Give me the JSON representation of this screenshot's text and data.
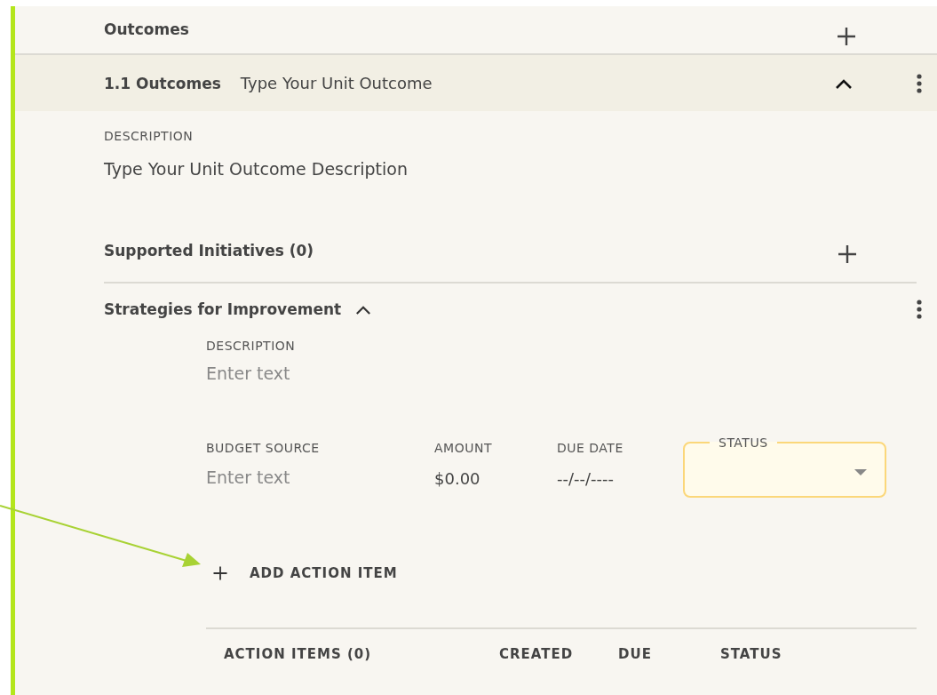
{
  "section": {
    "title": "Outcomes"
  },
  "outcome": {
    "number": "1.1 Outcomes",
    "title": "Type Your Unit Outcome",
    "expanded": true,
    "description_label": "DESCRIPTION",
    "description": "Type Your Unit Outcome Description"
  },
  "supported_initiatives": {
    "title": "Supported Initiatives (0)"
  },
  "strategies": {
    "title": "Strategies for Improvement",
    "expanded": true,
    "description_label": "DESCRIPTION",
    "description_placeholder": "Enter text",
    "fields": [
      {
        "kind": "input",
        "label": "BUDGET SOURCE",
        "placeholder": "Enter text"
      },
      {
        "kind": "value",
        "label": "AMOUNT",
        "value": "$0.00"
      },
      {
        "kind": "value",
        "label": "DUE DATE",
        "value": "--/--/----"
      },
      {
        "kind": "select",
        "label": "STATUS"
      }
    ],
    "add_button": "ADD ACTION ITEM",
    "table_columns": [
      "ACTION ITEMS (0)",
      "CREATED",
      "DUE",
      "STATUS"
    ]
  }
}
